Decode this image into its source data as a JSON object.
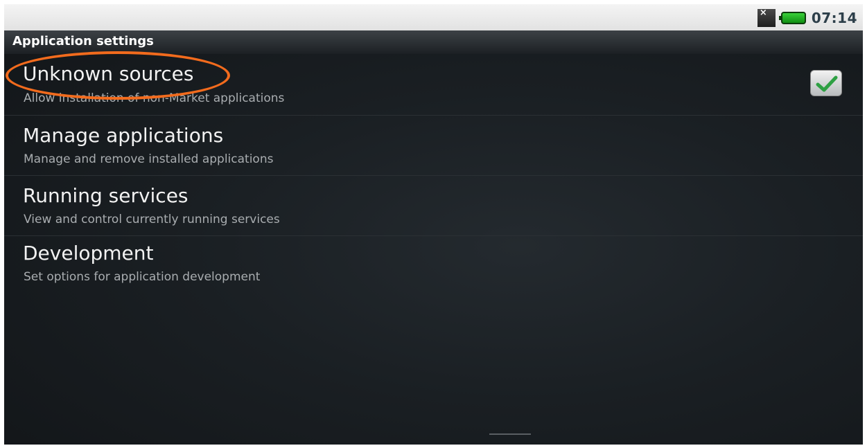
{
  "status_bar": {
    "time": "07:14",
    "signal_icon": "no-signal-icon",
    "signal_glyph": "×",
    "battery_icon": "battery-full-icon"
  },
  "header": {
    "title": "Application settings"
  },
  "settings": {
    "items": [
      {
        "title": "Unknown sources",
        "summary": "Allow installation of non-Market applications",
        "checked": true
      },
      {
        "title": "Manage applications",
        "summary": "Manage and remove installed applications"
      },
      {
        "title": "Running services",
        "summary": "View and control currently running services"
      },
      {
        "title": "Development",
        "summary": "Set options for application development"
      }
    ]
  },
  "colors": {
    "highlight": "#f26b1d",
    "check": "#2ea043"
  }
}
